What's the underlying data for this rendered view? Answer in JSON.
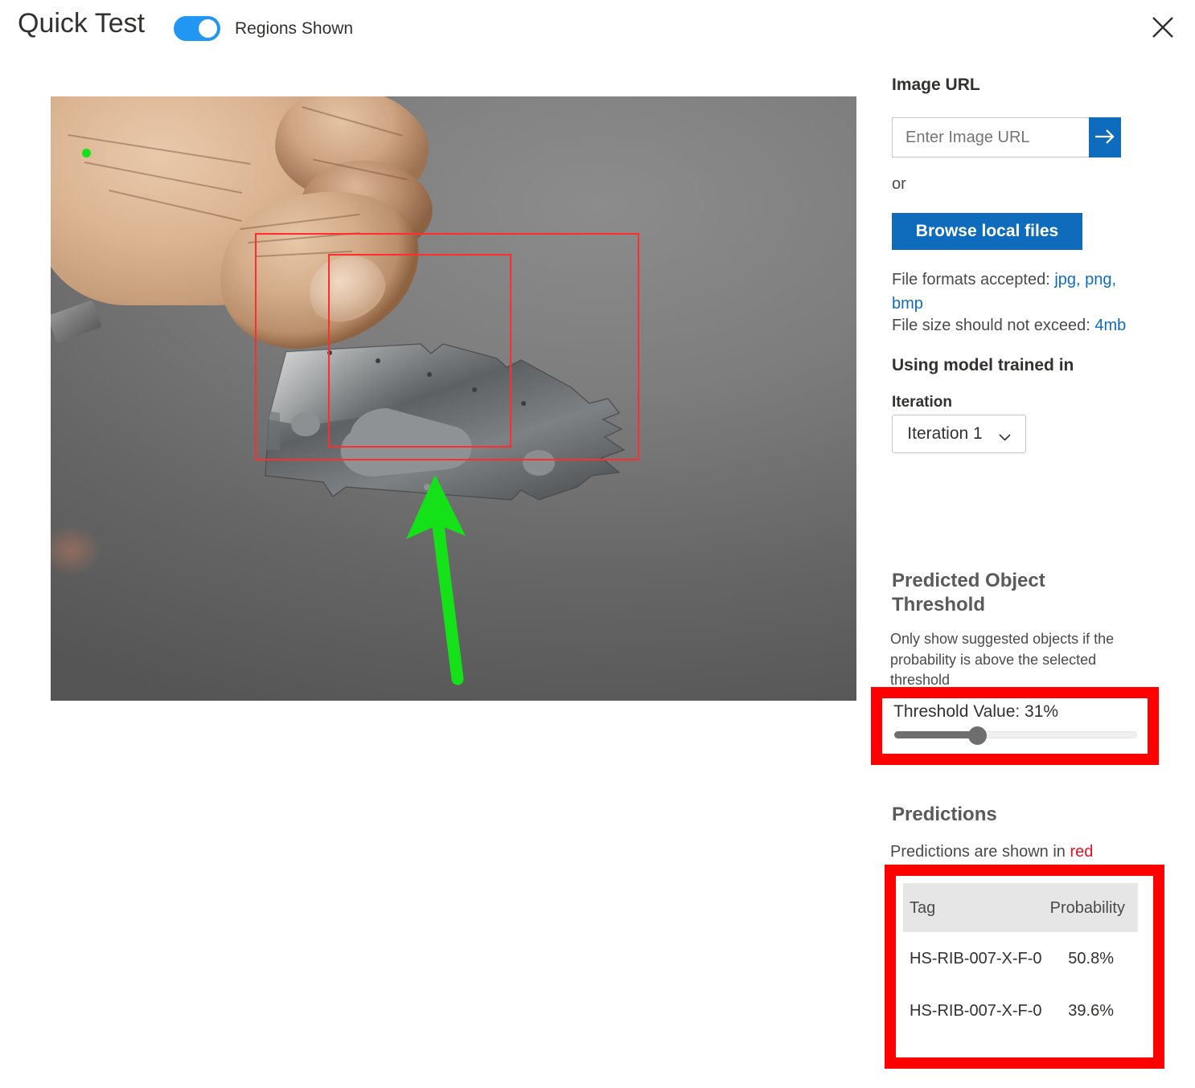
{
  "header": {
    "title": "Quick Test",
    "toggle_label": "Regions Shown",
    "toggle_on": true,
    "close_icon": "close-icon"
  },
  "image_panel": {
    "alt": "Hand holding a brushed stainless steel bracket against a grey backdrop",
    "annotations": {
      "green_dot": "green-dot-marker",
      "green_arrow": "green-arrow-pointing-up"
    },
    "prediction_boxes": [
      {
        "label": "outer-prediction-box",
        "color": "#ff2d2d"
      },
      {
        "label": "inner-prediction-box",
        "color": "#ff2d2d"
      }
    ]
  },
  "sidebar": {
    "image_url_label": "Image URL",
    "url_placeholder": "Enter Image URL",
    "url_value": "",
    "submit_icon": "arrow-right-icon",
    "or_text": "or",
    "browse_label": "Browse local files",
    "formats_prefix": "File formats accepted: ",
    "formats_value": "jpg, png, bmp",
    "filesize_prefix": "File size should not exceed: ",
    "filesize_value": "4mb",
    "using_model_label": "Using model trained in",
    "iteration_label": "Iteration",
    "iteration_value": "Iteration 1",
    "iteration_chevron": "chevron-down-icon"
  },
  "threshold": {
    "heading": "Predicted Object Threshold",
    "description": "Only show suggested objects if the probability is above the selected threshold",
    "value_label": "Threshold Value: 31%",
    "value_percent": 31
  },
  "predictions": {
    "heading": "Predictions",
    "subtitle_prefix": "Predictions are shown in ",
    "subtitle_color_word": "red",
    "columns": [
      "Tag",
      "Probability"
    ],
    "rows": [
      {
        "tag": "HS-RIB-007-X-F-0",
        "probability": "50.8%"
      },
      {
        "tag": "HS-RIB-007-X-F-0",
        "probability": "39.6%"
      }
    ]
  },
  "colors": {
    "accent_blue": "#0f6cbd",
    "toggle_blue": "#2196f3",
    "highlight_red": "#ff0000",
    "prediction_red": "#ff2d2d",
    "annotation_green": "#15e118"
  }
}
